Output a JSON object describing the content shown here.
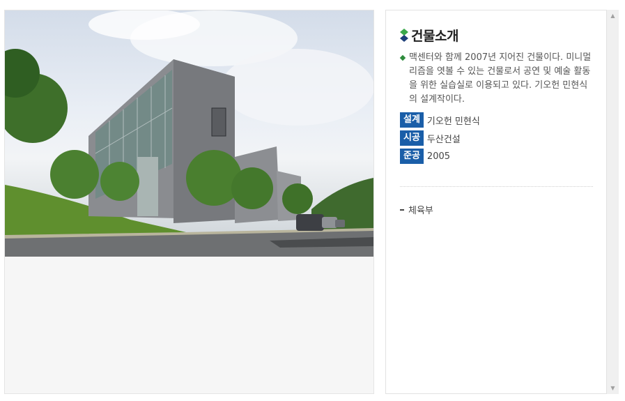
{
  "building": {
    "title": "건물소개",
    "description": "맥센터와 함께 2007년 지어진 건물이다. 미니멀리즘을 엿볼 수 있는 건물로서 공연 및 예술 활동을 위한 실습실로 이용되고 있다. 기오헌 민현식의 설계작이다.",
    "specs": [
      {
        "label": "설계",
        "value": "기오헌 민현식"
      },
      {
        "label": "시공",
        "value": "두산건설"
      },
      {
        "label": "준공",
        "value": "2005"
      }
    ],
    "department": "체육부"
  },
  "colors": {
    "accent_blue": "#1a5ea8",
    "bullet_green": "#2e8b3c",
    "title_icon_green": "#3aa84a",
    "title_icon_navy": "#1e3f7a"
  },
  "icons": {
    "title": "diamond-icon",
    "bullet": "diamond-bullet-icon",
    "scroll_up": "scroll-up-arrow-icon",
    "scroll_down": "scroll-down-arrow-icon"
  }
}
